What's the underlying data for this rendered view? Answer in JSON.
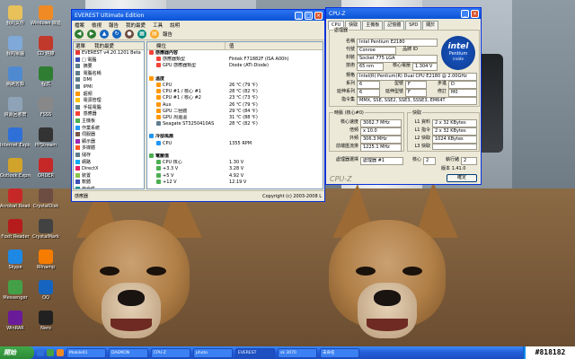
{
  "colors": {
    "title_blue": "#0a53d6",
    "window_face": "#ece9d8",
    "taskbar_blue": "#245edb",
    "start_green": "#2c8a35",
    "intel_blue": "#1a58c7"
  },
  "desktop_icons": [
    {
      "label": "我的文件",
      "icon": "folder-icon",
      "color": "#e8c15a"
    },
    {
      "label": "Windows 媒體",
      "icon": "media-player-icon",
      "color": "#f08a24"
    },
    {
      "label": "我的電腦",
      "icon": "computer-icon",
      "color": "#7fa9d8"
    },
    {
      "label": "CD 燒錄",
      "icon": "cd-icon",
      "color": "#c0392b"
    },
    {
      "label": "網路芳鄰",
      "icon": "network-icon",
      "color": "#4f8ad0"
    },
    {
      "label": "程式",
      "icon": "app-icon",
      "color": "#2e7d32"
    },
    {
      "label": "資源回收筒",
      "icon": "recycle-bin-icon",
      "color": "#8fa3b8"
    },
    {
      "label": "FSSS",
      "icon": "app-icon",
      "color": "#888"
    },
    {
      "label": "Internet Explorer",
      "icon": "ie-icon",
      "color": "#2f6fd8"
    },
    {
      "label": "PPStream",
      "icon": "app-icon",
      "color": "#333"
    },
    {
      "label": "Outlook Express",
      "icon": "mail-icon",
      "color": "#d2a32b"
    },
    {
      "label": "ORDER",
      "icon": "app-icon",
      "color": "#c62828"
    },
    {
      "label": "Acrobat Reader",
      "icon": "pdf-icon",
      "color": "#c62828"
    },
    {
      "label": "CrystalDisk",
      "icon": "app-icon",
      "color": "#6d4c41"
    },
    {
      "label": "Foxit Reader",
      "icon": "pdf-icon",
      "color": "#b71c1c"
    },
    {
      "label": "CrystalMark",
      "icon": "app-icon",
      "color": "#424242"
    },
    {
      "label": "Skype",
      "icon": "skype-icon",
      "color": "#1e88e5"
    },
    {
      "label": "Winamp",
      "icon": "app-icon",
      "color": "#f57c00"
    },
    {
      "label": "Messenger",
      "icon": "messenger-icon",
      "color": "#43a047"
    },
    {
      "label": "QQ",
      "icon": "app-icon",
      "color": "#1565c0"
    },
    {
      "label": "WinRAR",
      "icon": "app-icon",
      "color": "#6a1b9a"
    },
    {
      "label": "Nero",
      "icon": "app-icon",
      "color": "#212121"
    }
  ],
  "everest": {
    "title": "EVEREST Ultimate Edition",
    "menus": [
      "檔案",
      "檢視",
      "報告",
      "我的最愛",
      "工具",
      "說明"
    ],
    "toolbar_labels": [
      "報告"
    ],
    "tree_tabs": [
      "選單",
      "我的最愛"
    ],
    "tree": [
      {
        "label": "EVEREST v4.20.1201 Beta",
        "color": "#e53935"
      },
      {
        "label": "□ 電腦",
        "color": "#3f51b5"
      },
      {
        "label": "  摘要",
        "color": "#607d8b"
      },
      {
        "label": "  電腦名稱",
        "color": "#607d8b"
      },
      {
        "label": "  DMI",
        "color": "#607d8b"
      },
      {
        "label": "  IPMI",
        "color": "#607d8b"
      },
      {
        "label": "  超頻",
        "color": "#ff9800"
      },
      {
        "label": "  電源管理",
        "color": "#ffc107"
      },
      {
        "label": "  手提電腦",
        "color": "#607d8b"
      },
      {
        "label": "  感應器",
        "color": "#f44336"
      },
      {
        "label": "主機板",
        "color": "#4caf50"
      },
      {
        "label": "作業系統",
        "color": "#2196f3"
      },
      {
        "label": "伺服器",
        "color": "#795548"
      },
      {
        "label": "顯示器",
        "color": "#9c27b0"
      },
      {
        "label": "多媒體",
        "color": "#ff5722"
      },
      {
        "label": "儲存",
        "color": "#607d8b"
      },
      {
        "label": "網路",
        "color": "#03a9f4"
      },
      {
        "label": "DirectX",
        "color": "#e91e63"
      },
      {
        "label": "裝置",
        "color": "#8bc34a"
      },
      {
        "label": "軟體",
        "color": "#3f51b5"
      },
      {
        "label": "安全性",
        "color": "#009688"
      },
      {
        "label": "設定",
        "color": "#9e9e9e"
      }
    ],
    "col_headers": [
      "欄位",
      "值"
    ],
    "rows": [
      {
        "field": "感應器內容",
        "value": "",
        "section": true,
        "color": "#f44336"
      },
      {
        "field": "感應器類型",
        "value": "Fintek F71882F (ISA A00h)",
        "section": false,
        "color": "#f44336"
      },
      {
        "field": "GPU 感應器類型",
        "value": "Diode (ATI-Diode)",
        "section": false,
        "color": "#f44336"
      },
      {
        "field": "",
        "value": "",
        "section": false,
        "color": ""
      },
      {
        "field": "溫度",
        "value": "",
        "section": true,
        "color": "#ff9800"
      },
      {
        "field": "CPU",
        "value": "26 ℃ (79 ℉)",
        "section": false,
        "color": "#ff9800"
      },
      {
        "field": "CPU #1 / 核心 #1",
        "value": "28 ℃ (82 ℉)",
        "section": false,
        "color": "#ff9800"
      },
      {
        "field": "CPU #1 / 核心 #2",
        "value": "23 ℃ (73 ℉)",
        "section": false,
        "color": "#ff9800"
      },
      {
        "field": "Aux",
        "value": "26 ℃ (79 ℉)",
        "section": false,
        "color": "#ff9800"
      },
      {
        "field": "GPU 二極體",
        "value": "29 ℃ (84 ℉)",
        "section": false,
        "color": "#ff9800"
      },
      {
        "field": "GPU 周邊溫",
        "value": "31 ℃ (88 ℉)",
        "section": false,
        "color": "#ff9800"
      },
      {
        "field": "Seagate ST3250410AS",
        "value": "28 ℃ (82 ℉)",
        "section": false,
        "color": "#607d8b"
      },
      {
        "field": "",
        "value": "",
        "section": false,
        "color": ""
      },
      {
        "field": "冷卻風扇",
        "value": "",
        "section": true,
        "color": "#2196f3"
      },
      {
        "field": "CPU",
        "value": "1355 RPM",
        "section": false,
        "color": "#2196f3"
      },
      {
        "field": "",
        "value": "",
        "section": false,
        "color": ""
      },
      {
        "field": "電壓值",
        "value": "",
        "section": true,
        "color": "#4caf50"
      },
      {
        "field": "CPU 核心",
        "value": "1.30 V",
        "section": false,
        "color": "#4caf50"
      },
      {
        "field": "+3.3 V",
        "value": "3.28 V",
        "section": false,
        "color": "#4caf50"
      },
      {
        "field": "+5 V",
        "value": "4.92 V",
        "section": false,
        "color": "#4caf50"
      },
      {
        "field": "+12 V",
        "value": "12.19 V",
        "section": false,
        "color": "#4caf50"
      }
    ],
    "status_left": "感應器",
    "status_right": "Copyright (c) 2003-2008 L"
  },
  "cpuz": {
    "title": "CPU-Z",
    "tabs": [
      "CPU",
      "快取",
      "主機板",
      "記憶體",
      "SPD",
      "關於"
    ],
    "processor_group": "處理器",
    "name_label": "名稱",
    "name_value": "Intel Pentium E2180",
    "code_label": "代號",
    "code_value": "Conroe",
    "brand_label": "品牌 ID",
    "package_label": "封裝",
    "package_value": "Socket 775 LGA",
    "tech_label": "技術",
    "tech_value": "65 nm",
    "voltage_label": "核心電壓",
    "voltage_value": "1.304 V",
    "spec_label": "規格",
    "spec_value": "Intel(R) Pentium(R) Dual  CPU  E2180 @ 2.00GHz",
    "family_label": "系列",
    "family_value": "6",
    "model_label": "型號",
    "model_value": "F",
    "stepping_label": "步進",
    "stepping_value": "D",
    "extfam_label": "延伸系列",
    "extfam_value": "6",
    "extmodel_label": "延伸型號",
    "extmodel_value": "F",
    "revision_label": "修訂",
    "revision_value": "M0",
    "instr_label": "指令集",
    "instr_value": "MMX, SSE, SSE2, SSE3, SSSE3, EM64T",
    "intel_brand": "intel",
    "intel_sub": "Pentium",
    "intel_sub2": "inside",
    "clocks_group": "時脈 (核心#0)",
    "core_speed_label": "核心速度",
    "core_speed_value": "3062.7 MHz",
    "multi_label": "倍頻",
    "multi_value": "x 10.0",
    "bus_label": "外頻",
    "bus_value": "306.3 MHz",
    "fsb_label": "前端匯流排",
    "fsb_value": "1225.1 MHz",
    "cache_group": "快取",
    "l1d_label": "L1 資料",
    "l1d_value": "2 x 32 KBytes",
    "l1i_label": "L1 指令",
    "l1i_value": "2 x 32 KBytes",
    "l2_label": "L2 快取",
    "l2_value": "1024 KBytes",
    "l3_label": "L3 快取",
    "l3_value": "",
    "selection_label": "處理器選擇",
    "selection_value": "處理器 #1",
    "cores_label": "核心",
    "cores_value": "2",
    "threads_label": "執行緒",
    "threads_value": "2",
    "version_label": "版本 1.41.0",
    "ok_label": "確定",
    "brand_footer": "CPU-Z"
  },
  "taskbar": {
    "start": "開始",
    "tasks": [
      "Mobile01",
      "DAEMON",
      "CPU-Z",
      "photo",
      "EVEREST",
      "sk 3070",
      "未命名"
    ],
    "active_index": 4
  },
  "watermark": "#818182"
}
